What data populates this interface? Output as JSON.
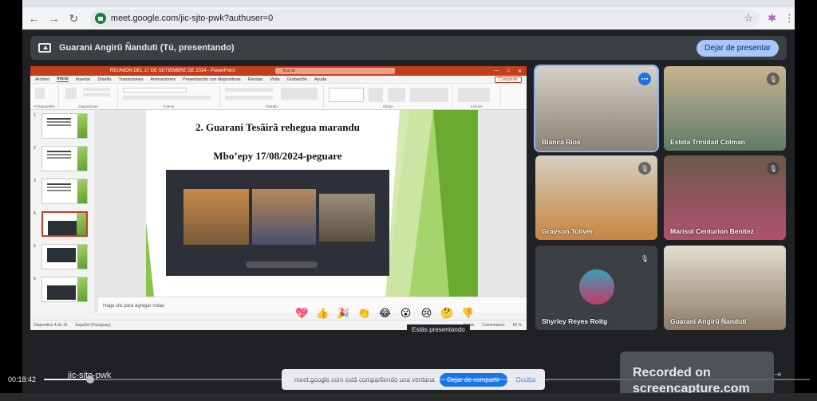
{
  "browser": {
    "url": "meet.google.com/jic-sjto-pwk?authuser=0",
    "back_icon": "arrow-left-icon",
    "forward_icon": "arrow-right-icon",
    "reload_icon": "reload-icon"
  },
  "meet": {
    "presenting_banner": "Guarani Angirũ Ñanduti (Tú, presentando)",
    "stop_presenting_button": "Dejar de presentar",
    "meeting_code": "jic-sjto-pwk",
    "presenting_label": "Estás presentando",
    "reactions": [
      "💖",
      "👍",
      "🎉",
      "👏",
      "😂",
      "😮",
      "😢",
      "🤔",
      "👎"
    ],
    "share_bar": {
      "text": "meet.google.com está compartiendo una ventana",
      "stop_button": "Dejar de compartir",
      "hide_button": "Ocultar"
    },
    "accent": "#a8c7fa"
  },
  "participants": [
    {
      "name": "Blanca Rios",
      "muted": false,
      "speaking": true
    },
    {
      "name": "Estela Trinidad Colman",
      "muted": true
    },
    {
      "name": "Grayson Toliver",
      "muted": true
    },
    {
      "name": "Marisol Centurion Benitez",
      "muted": true
    },
    {
      "name": "Shyrley Reyes Roitg",
      "muted": true
    },
    {
      "name": "Guarani Angirũ Ñanduti",
      "muted": false
    }
  ],
  "powerpoint": {
    "window_title": "REUNION DEL 17 DE SETIEMBRE DE 2024 - PowerPoint",
    "search_placeholder": "Buscar",
    "menu": [
      "Archivo",
      "Inicio",
      "Insertar",
      "Diseño",
      "Transiciones",
      "Animaciones",
      "Presentación con diapositivas",
      "Revisar",
      "Vista",
      "Grabación",
      "Ayuda"
    ],
    "share_button": "Compartir",
    "ribbon_groups": [
      "Portapapeles",
      "Diapositivas",
      "Fuente",
      "Párrafo",
      "Dibujo",
      "Edición"
    ],
    "slide_title_line1": "2. Guarani Tesãirã rehegua marandu",
    "slide_title_line2": "Mbo’epy 17/08/2024-peguare",
    "notes_placeholder": "Haga clic para agregar notas",
    "status_left": "Diapositiva 4 de 16",
    "status_lang": "Español (Paraguay)",
    "status_notes": "Notas",
    "status_comments": "Comentarios",
    "zoom": "60 %",
    "thumb_numbers": [
      "1",
      "2",
      "3",
      "4",
      "5",
      "6"
    ]
  },
  "player": {
    "time": "00:18:42",
    "progress": 0.06
  },
  "watermark": {
    "line1": "Recorded on",
    "line2": "screencapture.com"
  }
}
